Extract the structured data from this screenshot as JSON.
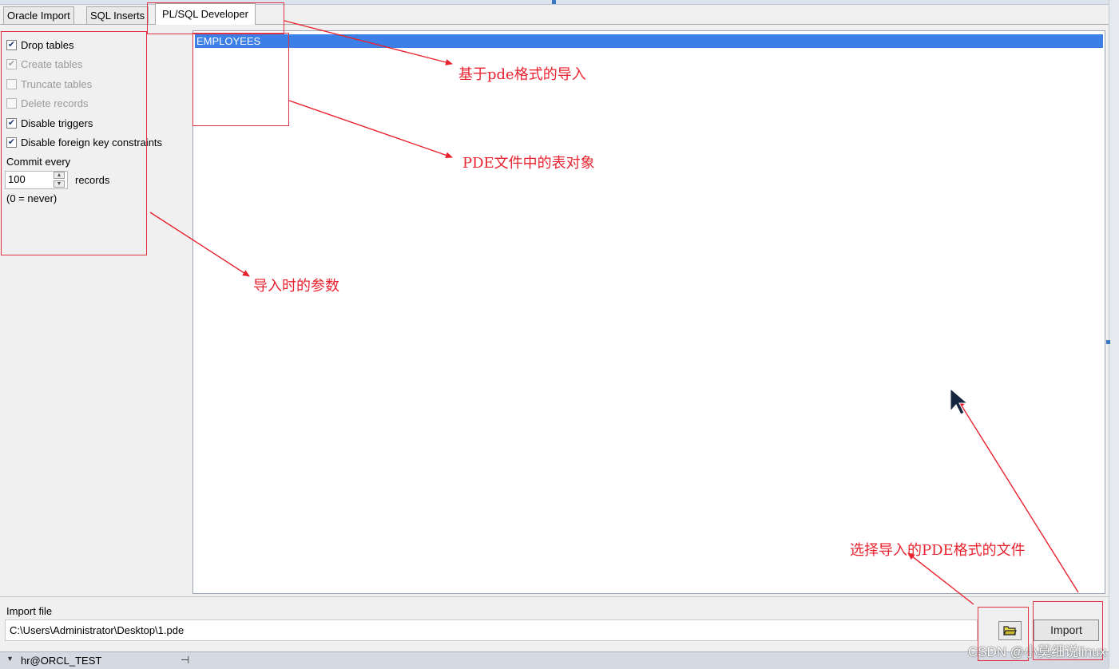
{
  "tabs": [
    {
      "label": "Oracle Import"
    },
    {
      "label": "SQL Inserts"
    },
    {
      "label": "PL/SQL Developer"
    }
  ],
  "options": [
    {
      "label": "Drop tables",
      "checked": true,
      "enabled": true
    },
    {
      "label": "Create tables",
      "checked": true,
      "enabled": false
    },
    {
      "label": "Truncate tables",
      "checked": false,
      "enabled": false
    },
    {
      "label": "Delete records",
      "checked": false,
      "enabled": false
    },
    {
      "label": "Disable triggers",
      "checked": true,
      "enabled": true
    },
    {
      "label": "Disable foreign key constraints",
      "checked": true,
      "enabled": true
    }
  ],
  "commit": {
    "label": "Commit every",
    "value": "100",
    "unit": "records",
    "hint": "(0 = never)"
  },
  "tables": [
    "EMPLOYEES"
  ],
  "import_file": {
    "label": "Import file",
    "path": "C:\\Users\\Administrator\\Desktop\\1.pde",
    "import_button": "Import"
  },
  "status": {
    "connection": "hr@ORCL_TEST"
  },
  "annotations": {
    "pde_import": "基于pde格式的导入",
    "table_objects": "PDE文件中的表对象",
    "parameters": "导入时的参数",
    "select_file": "选择导入的PDE格式的文件"
  },
  "watermark": "CSDN @小莫细说linux",
  "colors": {
    "selection": "#3c7fe6",
    "annotation": "#e8232f"
  },
  "icons": [
    "checkbox-check-icon",
    "spin-up-icon",
    "spin-down-icon",
    "folder-open-icon",
    "dropdown-arrow-icon",
    "pin-icon",
    "mouse-cursor-icon"
  ]
}
